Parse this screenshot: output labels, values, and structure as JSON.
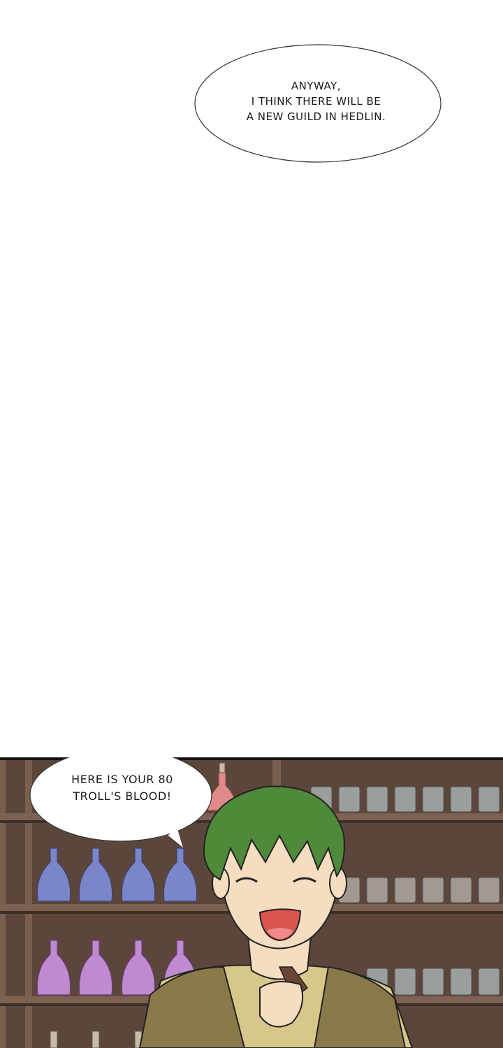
{
  "panel_top": {
    "speech_bubble": {
      "lines": [
        "ANYWAY,",
        "I THINK THERE WILL BE",
        "A NEW GUILD IN HEDLIN."
      ]
    }
  },
  "panel_bottom": {
    "speech_bubble": {
      "lines": [
        "HERE IS YOUR 80",
        "TROLL'S BLOOD!"
      ]
    },
    "colors": {
      "shelf_wood": "#6b5346",
      "shelf_dark": "#4a3830",
      "potion_blue": "#7b86c9",
      "potion_pink": "#c08ad0",
      "potion_red": "#e08a8a",
      "jar_gray": "#9a9e9c",
      "hair_green": "#4f8a3a",
      "skin": "#f6ddc0",
      "vest": "#8a7a4a",
      "shirt": "#d8c78a"
    }
  }
}
